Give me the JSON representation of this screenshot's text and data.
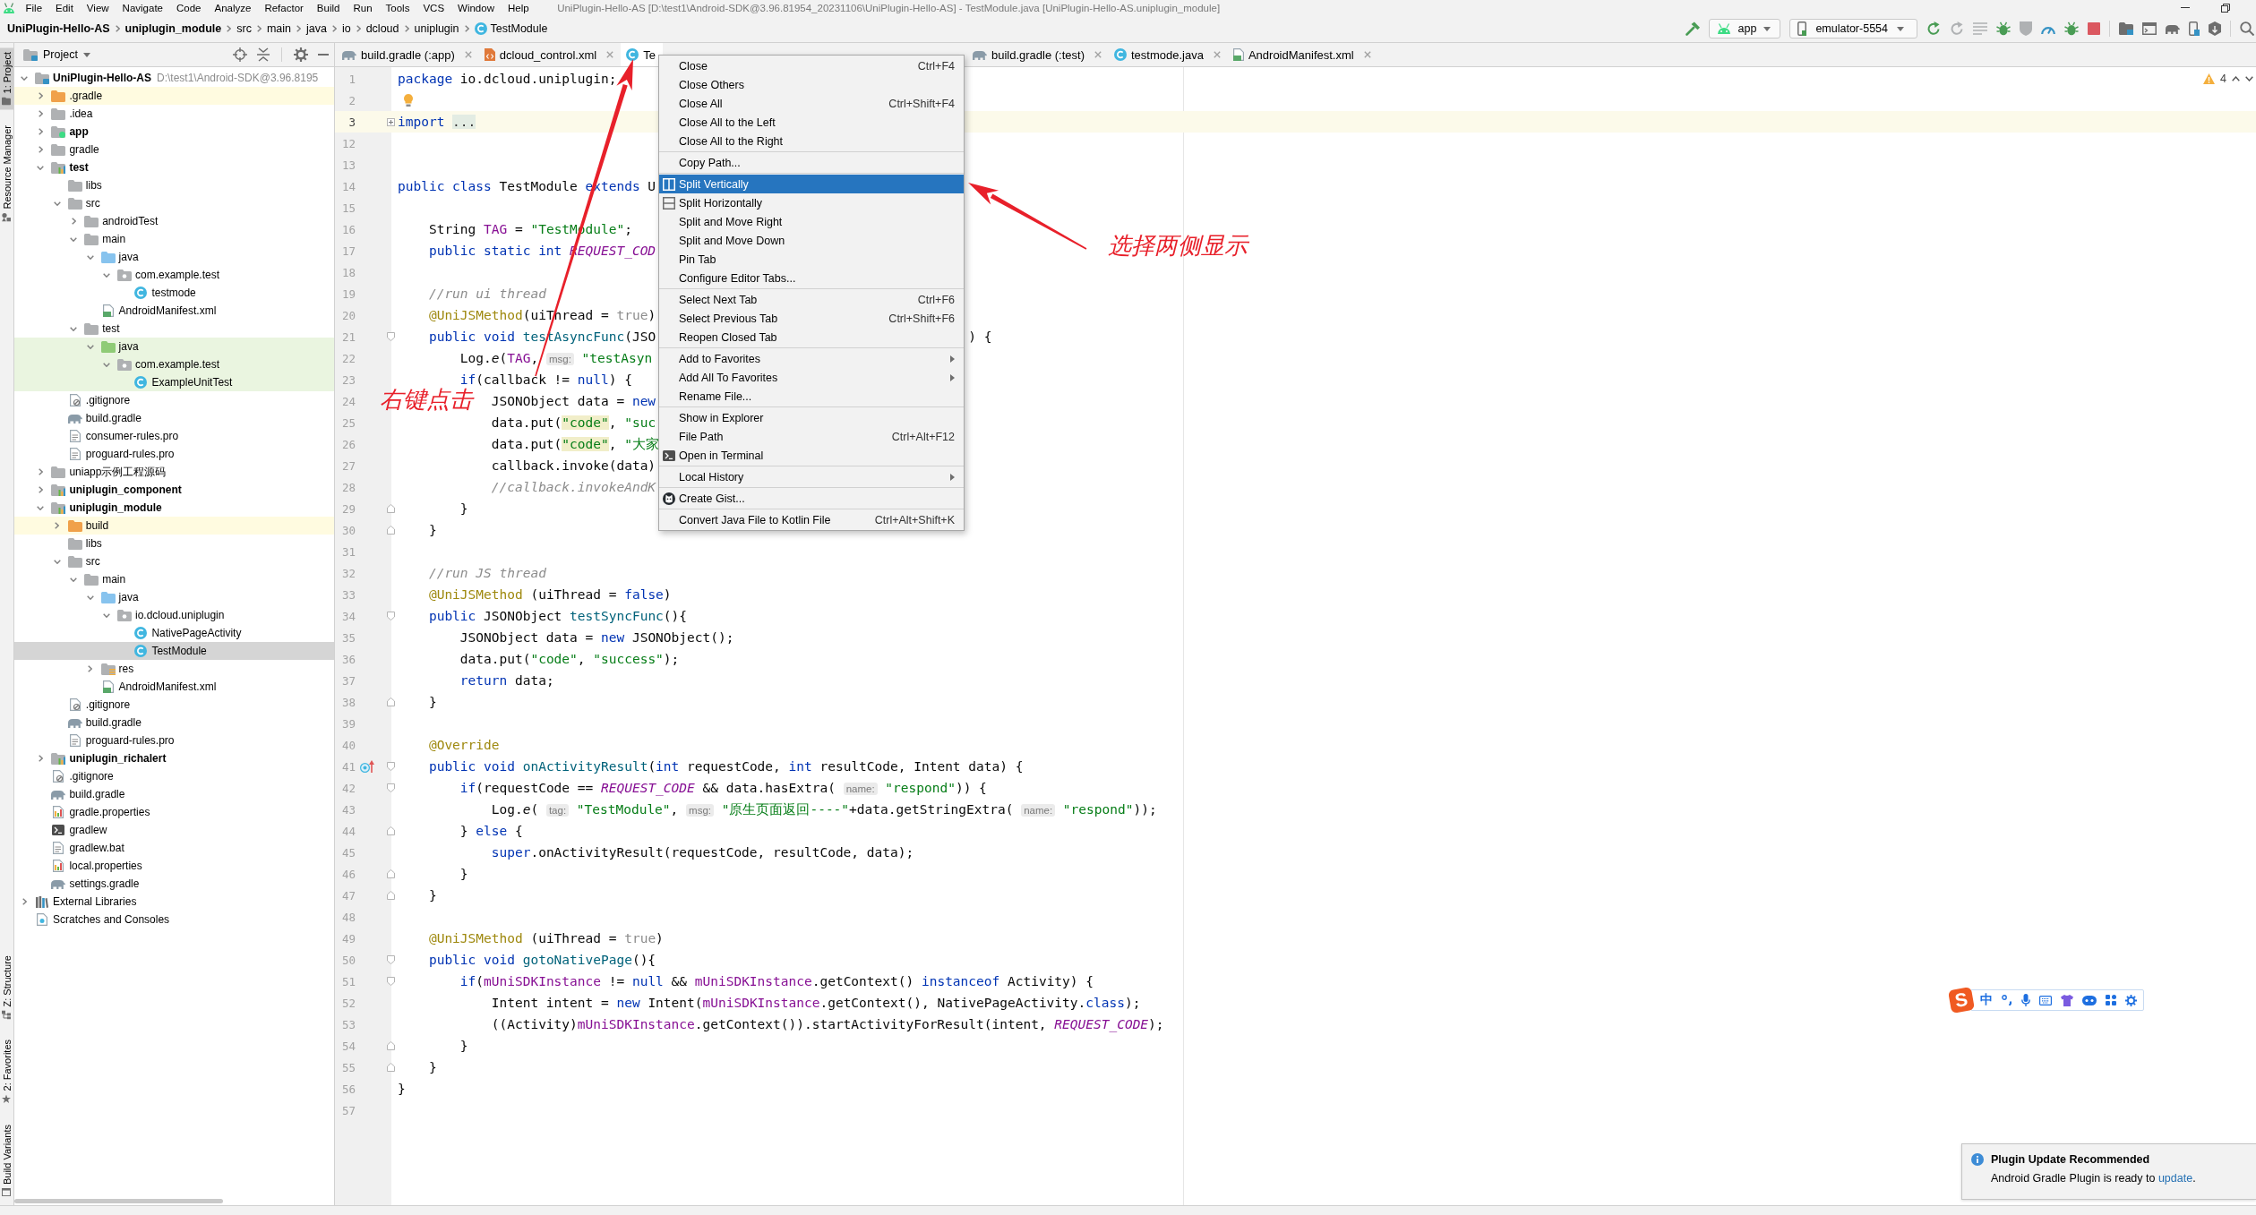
{
  "window": {
    "title": "UniPlugin-Hello-AS [D:\\test1\\Android-SDK@3.96.81954_20231106\\UniPlugin-Hello-AS] - TestModule.java [UniPlugin-Hello-AS.uniplugin_module]"
  },
  "menu_bar": [
    "File",
    "Edit",
    "View",
    "Navigate",
    "Code",
    "Analyze",
    "Refactor",
    "Build",
    "Run",
    "Tools",
    "VCS",
    "Window",
    "Help"
  ],
  "breadcrumbs": [
    {
      "label": "UniPlugin-Hello-AS",
      "kind": "project"
    },
    {
      "label": "uniplugin_module",
      "kind": "module"
    },
    {
      "label": "src",
      "kind": "folder"
    },
    {
      "label": "main",
      "kind": "folder"
    },
    {
      "label": "java",
      "kind": "folder"
    },
    {
      "label": "io",
      "kind": "folder"
    },
    {
      "label": "dcloud",
      "kind": "folder"
    },
    {
      "label": "uniplugin",
      "kind": "folder"
    },
    {
      "label": "TestModule",
      "kind": "class"
    }
  ],
  "run_toolbar": {
    "configuration": "app",
    "device": "emulator-5554"
  },
  "tool_windows": {
    "top": [
      {
        "label": "1: Project",
        "kind": "project",
        "selected": true
      },
      {
        "label": "Resource Manager",
        "kind": "resources",
        "selected": false
      }
    ],
    "bottom": [
      {
        "label": "Z: Structure",
        "kind": "structure",
        "selected": false
      },
      {
        "label": "2: Favorites",
        "kind": "favorites",
        "selected": false
      },
      {
        "label": "Build Variants",
        "kind": "variants",
        "selected": false
      }
    ]
  },
  "project_panel": {
    "title": "Project",
    "tree": [
      {
        "label": "UniPlugin-Hello-AS",
        "path": "D:\\test1\\Android-SDK@3.96.8195",
        "kind": "project",
        "expanded": true,
        "selected": false,
        "children": [
          {
            "label": ".gradle",
            "kind": "excluded-folder",
            "expanded": false,
            "selected": false
          },
          {
            "label": ".idea",
            "kind": "folder",
            "expanded": false,
            "selected": false
          },
          {
            "label": "app",
            "kind": "app-module",
            "expanded": false,
            "selected": false
          },
          {
            "label": "gradle",
            "kind": "folder",
            "expanded": false,
            "selected": false
          },
          {
            "label": "test",
            "kind": "library-module",
            "expanded": true,
            "selected": false,
            "children": [
              {
                "label": "libs",
                "kind": "folder",
                "selected": false
              },
              {
                "label": "src",
                "kind": "folder",
                "expanded": true,
                "selected": false,
                "children": [
                  {
                    "label": "androidTest",
                    "kind": "folder",
                    "expanded": false,
                    "selected": false
                  },
                  {
                    "label": "main",
                    "kind": "folder",
                    "expanded": true,
                    "selected": false,
                    "children": [
                      {
                        "label": "java",
                        "kind": "source-folder",
                        "expanded": true,
                        "selected": false,
                        "children": [
                          {
                            "label": "com.example.test",
                            "kind": "package",
                            "expanded": true,
                            "selected": false,
                            "children": [
                              {
                                "label": "testmode",
                                "kind": "class",
                                "selected": false
                              }
                            ]
                          }
                        ]
                      },
                      {
                        "label": "AndroidManifest.xml",
                        "kind": "manifest",
                        "selected": false
                      }
                    ]
                  },
                  {
                    "label": "test",
                    "kind": "folder",
                    "expanded": true,
                    "selected": false,
                    "children": [
                      {
                        "label": "java",
                        "kind": "test-folder",
                        "expanded": true,
                        "selected": false,
                        "children": [
                          {
                            "label": "com.example.test",
                            "kind": "package",
                            "expanded": true,
                            "selected": false,
                            "children": [
                              {
                                "label": "ExampleUnitTest",
                                "kind": "class",
                                "selected": false
                              }
                            ]
                          }
                        ]
                      }
                    ]
                  }
                ]
              },
              {
                "label": ".gitignore",
                "kind": "ignore-file",
                "selected": false
              },
              {
                "label": "build.gradle",
                "kind": "gradle-file",
                "selected": false
              },
              {
                "label": "consumer-rules.pro",
                "kind": "text-file",
                "selected": false
              },
              {
                "label": "proguard-rules.pro",
                "kind": "text-file",
                "selected": false
              }
            ]
          },
          {
            "label": "uniapp示例工程源码",
            "kind": "folder",
            "expanded": false,
            "selected": false
          },
          {
            "label": "uniplugin_component",
            "kind": "library-module",
            "expanded": false,
            "selected": false
          },
          {
            "label": "uniplugin_module",
            "kind": "library-module",
            "expanded": true,
            "selected": false,
            "children": [
              {
                "label": "build",
                "kind": "excluded-folder",
                "expanded": false,
                "selected": false
              },
              {
                "label": "libs",
                "kind": "folder",
                "selected": false
              },
              {
                "label": "src",
                "kind": "folder",
                "expanded": true,
                "selected": false,
                "children": [
                  {
                    "label": "main",
                    "kind": "folder",
                    "expanded": true,
                    "selected": false,
                    "children": [
                      {
                        "label": "java",
                        "kind": "source-folder",
                        "expanded": true,
                        "selected": false,
                        "children": [
                          {
                            "label": "io.dcloud.uniplugin",
                            "kind": "package",
                            "expanded": true,
                            "selected": false,
                            "children": [
                              {
                                "label": "NativePageActivity",
                                "kind": "class",
                                "selected": false
                              },
                              {
                                "label": "TestModule",
                                "kind": "class",
                                "selected": true
                              }
                            ]
                          }
                        ]
                      },
                      {
                        "label": "res",
                        "kind": "resource-folder",
                        "expanded": false,
                        "selected": false
                      },
                      {
                        "label": "AndroidManifest.xml",
                        "kind": "manifest",
                        "selected": false
                      }
                    ]
                  }
                ]
              },
              {
                "label": ".gitignore",
                "kind": "ignore-file",
                "selected": false
              },
              {
                "label": "build.gradle",
                "kind": "gradle-file",
                "selected": false
              },
              {
                "label": "proguard-rules.pro",
                "kind": "text-file",
                "selected": false
              }
            ]
          },
          {
            "label": "uniplugin_richalert",
            "kind": "library-module",
            "expanded": false,
            "selected": false
          },
          {
            "label": ".gitignore",
            "kind": "ignore-file",
            "selected": false
          },
          {
            "label": "build.gradle",
            "kind": "gradle-file",
            "selected": false
          },
          {
            "label": "gradle.properties",
            "kind": "properties-file",
            "selected": false
          },
          {
            "label": "gradlew",
            "kind": "script",
            "selected": false
          },
          {
            "label": "gradlew.bat",
            "kind": "text-file",
            "selected": false
          },
          {
            "label": "local.properties",
            "kind": "properties-file",
            "selected": false
          },
          {
            "label": "settings.gradle",
            "kind": "gradle-file",
            "selected": false
          }
        ]
      },
      {
        "label": "External Libraries",
        "kind": "libraries",
        "expanded": false,
        "selected": false
      },
      {
        "label": "Scratches and Consoles",
        "kind": "scratches",
        "selected": false
      }
    ]
  },
  "editor_tabs": [
    {
      "label": "build.gradle (:app)",
      "kind": "gradle",
      "selected": false
    },
    {
      "label": "dcloud_control.xml",
      "kind": "xml",
      "selected": false
    },
    {
      "label": "Te",
      "kind": "java",
      "selected": true
    },
    {
      "label": "build.gradle (:test)",
      "kind": "gradle",
      "selected": false
    },
    {
      "label": "testmode.java",
      "kind": "java",
      "selected": false
    },
    {
      "label": "AndroidManifest.xml",
      "kind": "manifest",
      "selected": false
    }
  ],
  "editor": {
    "problems": "4",
    "lines": [
      {
        "number": "1",
        "current": false,
        "tokens": [
          {
            "kind": "kw",
            "text": "package"
          },
          {
            "kind": "txt",
            "text": " io.dcloud.uniplugin;"
          }
        ]
      },
      {
        "number": "2",
        "current": false,
        "markers": [
          {
            "kind": "intention"
          }
        ]
      },
      {
        "number": "3",
        "current": true,
        "markers": [
          {
            "kind": "folded"
          }
        ],
        "tokens": [
          {
            "kind": "kw",
            "text": "import "
          },
          {
            "kind": "folded",
            "text": "..."
          }
        ]
      },
      {
        "number": "12",
        "current": false
      },
      {
        "number": "13",
        "current": false
      },
      {
        "number": "14",
        "current": false,
        "tokens": [
          {
            "kind": "kw",
            "text": "public class"
          },
          {
            "kind": "txt",
            "text": " TestModule "
          },
          {
            "kind": "kw",
            "text": "extends"
          },
          {
            "kind": "txt",
            "text": " U"
          }
        ]
      },
      {
        "number": "15",
        "current": false
      },
      {
        "number": "16",
        "current": false,
        "tokens": [
          {
            "kind": "txt",
            "text": "    String "
          },
          {
            "kind": "field",
            "text": "TAG"
          },
          {
            "kind": "txt",
            "text": " = "
          },
          {
            "kind": "str",
            "text": "\"TestModule\""
          },
          {
            "kind": "txt",
            "text": ";"
          }
        ]
      },
      {
        "number": "17",
        "current": false,
        "tokens": [
          {
            "kind": "kw",
            "text": "    public static int "
          },
          {
            "kind": "const",
            "text": "REQUEST_COD"
          }
        ]
      },
      {
        "number": "18",
        "current": false
      },
      {
        "number": "19",
        "current": false,
        "tokens": [
          {
            "kind": "comment",
            "text": "    //run ui thread"
          }
        ]
      },
      {
        "number": "20",
        "current": false,
        "tokens": [
          {
            "kind": "annotation",
            "text": "    @UniJSMethod"
          },
          {
            "kind": "txt",
            "text": "(uiThread = "
          },
          {
            "kind": "muted",
            "text": "true"
          },
          {
            "kind": "txt",
            "text": ")"
          }
        ]
      },
      {
        "number": "21",
        "current": false,
        "markers": [
          {
            "kind": "fold-start"
          }
        ],
        "tokens": [
          {
            "kind": "kw",
            "text": "    public void "
          },
          {
            "kind": "method",
            "text": "testAsyncFunc"
          },
          {
            "kind": "txt",
            "text": "(JSO"
          }
        ],
        "tail": [
          {
            "kind": "txt",
            "text": ") {"
          }
        ]
      },
      {
        "number": "22",
        "current": false,
        "tokens": [
          {
            "kind": "txt",
            "text": "        Log."
          },
          {
            "kind": "call",
            "text": "e"
          },
          {
            "kind": "txt",
            "text": "("
          },
          {
            "kind": "field",
            "text": "TAG"
          },
          {
            "kind": "txt",
            "text": ", "
          },
          {
            "kind": "hint",
            "text": "msg:"
          },
          {
            "kind": "str",
            "text": " \"testAsyn"
          }
        ]
      },
      {
        "number": "23",
        "current": false,
        "tokens": [
          {
            "kind": "kw",
            "text": "        if"
          },
          {
            "kind": "txt",
            "text": "(callback != "
          },
          {
            "kind": "kw",
            "text": "null"
          },
          {
            "kind": "txt",
            "text": ") {"
          }
        ]
      },
      {
        "number": "24",
        "current": false,
        "tokens": [
          {
            "kind": "txt",
            "text": "            JSONObject data = "
          },
          {
            "kind": "kw",
            "text": "new"
          }
        ]
      },
      {
        "number": "25",
        "current": false,
        "tokens": [
          {
            "kind": "txt",
            "text": "            data.put("
          },
          {
            "kind": "marked",
            "text": "\"code\""
          },
          {
            "kind": "txt",
            "text": ", "
          },
          {
            "kind": "str",
            "text": "\"suc"
          }
        ]
      },
      {
        "number": "26",
        "current": false,
        "tokens": [
          {
            "kind": "txt",
            "text": "            data.put("
          },
          {
            "kind": "marked",
            "text": "\"code\""
          },
          {
            "kind": "txt",
            "text": ", "
          },
          {
            "kind": "str",
            "text": "\"大家"
          }
        ]
      },
      {
        "number": "27",
        "current": false,
        "tokens": [
          {
            "kind": "txt",
            "text": "            callback.invoke(data)"
          }
        ]
      },
      {
        "number": "28",
        "current": false,
        "tokens": [
          {
            "kind": "comment",
            "text": "            //callback.invokeAndK"
          }
        ]
      },
      {
        "number": "29",
        "current": false,
        "markers": [
          {
            "kind": "fold-end"
          }
        ],
        "tokens": [
          {
            "kind": "txt",
            "text": "        }"
          }
        ]
      },
      {
        "number": "30",
        "current": false,
        "markers": [
          {
            "kind": "fold-end"
          }
        ],
        "tokens": [
          {
            "kind": "txt",
            "text": "    }"
          }
        ]
      },
      {
        "number": "31",
        "current": false
      },
      {
        "number": "32",
        "current": false,
        "tokens": [
          {
            "kind": "comment",
            "text": "    //run JS thread"
          }
        ]
      },
      {
        "number": "33",
        "current": false,
        "tokens": [
          {
            "kind": "annotation",
            "text": "    @UniJSMethod"
          },
          {
            "kind": "txt",
            "text": " (uiThread = "
          },
          {
            "kind": "kw",
            "text": "false"
          },
          {
            "kind": "txt",
            "text": ")"
          }
        ]
      },
      {
        "number": "34",
        "current": false,
        "markers": [
          {
            "kind": "fold-start"
          }
        ],
        "tokens": [
          {
            "kind": "kw",
            "text": "    public"
          },
          {
            "kind": "txt",
            "text": " JSONObject "
          },
          {
            "kind": "method",
            "text": "testSyncFunc"
          },
          {
            "kind": "txt",
            "text": "(){"
          }
        ]
      },
      {
        "number": "35",
        "current": false,
        "tokens": [
          {
            "kind": "txt",
            "text": "        JSONObject data = "
          },
          {
            "kind": "kw",
            "text": "new"
          },
          {
            "kind": "txt",
            "text": " JSONObject();"
          }
        ]
      },
      {
        "number": "36",
        "current": false,
        "tokens": [
          {
            "kind": "txt",
            "text": "        data.put("
          },
          {
            "kind": "str",
            "text": "\"code\""
          },
          {
            "kind": "txt",
            "text": ", "
          },
          {
            "kind": "str",
            "text": "\"success\""
          },
          {
            "kind": "txt",
            "text": ");"
          }
        ]
      },
      {
        "number": "37",
        "current": false,
        "tokens": [
          {
            "kind": "kw",
            "text": "        return"
          },
          {
            "kind": "txt",
            "text": " data;"
          }
        ]
      },
      {
        "number": "38",
        "current": false,
        "markers": [
          {
            "kind": "fold-end"
          }
        ],
        "tokens": [
          {
            "kind": "txt",
            "text": "    }"
          }
        ]
      },
      {
        "number": "39",
        "current": false
      },
      {
        "number": "40",
        "current": false,
        "tokens": [
          {
            "kind": "annotation",
            "text": "    @Override"
          }
        ]
      },
      {
        "number": "41",
        "current": false,
        "markers": [
          {
            "kind": "override"
          },
          {
            "kind": "fold-start"
          }
        ],
        "tokens": [
          {
            "kind": "kw",
            "text": "    public void "
          },
          {
            "kind": "method",
            "text": "onActivityResult"
          },
          {
            "kind": "txt",
            "text": "("
          },
          {
            "kind": "kw",
            "text": "int"
          },
          {
            "kind": "txt",
            "text": " requestCode, "
          },
          {
            "kind": "kw",
            "text": "int"
          },
          {
            "kind": "txt",
            "text": " resultCode, Intent data) {"
          }
        ]
      },
      {
        "number": "42",
        "current": false,
        "markers": [
          {
            "kind": "fold-start"
          }
        ],
        "tokens": [
          {
            "kind": "kw",
            "text": "        if"
          },
          {
            "kind": "txt",
            "text": "(requestCode == "
          },
          {
            "kind": "const",
            "text": "REQUEST_CODE"
          },
          {
            "kind": "txt",
            "text": " && data.hasExtra( "
          },
          {
            "kind": "hint",
            "text": "name:"
          },
          {
            "kind": "str",
            "text": " \"respond\""
          },
          {
            "kind": "txt",
            "text": ")) {"
          }
        ]
      },
      {
        "number": "43",
        "current": false,
        "tokens": [
          {
            "kind": "txt",
            "text": "            Log."
          },
          {
            "kind": "call",
            "text": "e"
          },
          {
            "kind": "txt",
            "text": "( "
          },
          {
            "kind": "hint",
            "text": "tag:"
          },
          {
            "kind": "str",
            "text": " \"TestModule\""
          },
          {
            "kind": "txt",
            "text": ", "
          },
          {
            "kind": "hint",
            "text": "msg:"
          },
          {
            "kind": "str",
            "text": " \"原生页面返回----\""
          },
          {
            "kind": "txt",
            "text": "+data.getStringExtra( "
          },
          {
            "kind": "hint",
            "text": "name:"
          },
          {
            "kind": "str",
            "text": " \"respond\""
          },
          {
            "kind": "txt",
            "text": "));"
          }
        ]
      },
      {
        "number": "44",
        "current": false,
        "markers": [
          {
            "kind": "fold-end"
          }
        ],
        "tokens": [
          {
            "kind": "txt",
            "text": "        } "
          },
          {
            "kind": "kw",
            "text": "else"
          },
          {
            "kind": "txt",
            "text": " {"
          }
        ]
      },
      {
        "number": "45",
        "current": false,
        "tokens": [
          {
            "kind": "kw",
            "text": "            super"
          },
          {
            "kind": "txt",
            "text": ".onActivityResult(requestCode, resultCode, data);"
          }
        ]
      },
      {
        "number": "46",
        "current": false,
        "markers": [
          {
            "kind": "fold-end"
          }
        ],
        "tokens": [
          {
            "kind": "txt",
            "text": "        }"
          }
        ]
      },
      {
        "number": "47",
        "current": false,
        "markers": [
          {
            "kind": "fold-end"
          }
        ],
        "tokens": [
          {
            "kind": "txt",
            "text": "    }"
          }
        ]
      },
      {
        "number": "48",
        "current": false
      },
      {
        "number": "49",
        "current": false,
        "tokens": [
          {
            "kind": "annotation",
            "text": "    @UniJSMethod"
          },
          {
            "kind": "txt",
            "text": " (uiThread = "
          },
          {
            "kind": "muted",
            "text": "true"
          },
          {
            "kind": "txt",
            "text": ")"
          }
        ]
      },
      {
        "number": "50",
        "current": false,
        "markers": [
          {
            "kind": "fold-start"
          }
        ],
        "tokens": [
          {
            "kind": "kw",
            "text": "    public void "
          },
          {
            "kind": "method",
            "text": "gotoNativePage"
          },
          {
            "kind": "txt",
            "text": "(){"
          }
        ]
      },
      {
        "number": "51",
        "current": false,
        "markers": [
          {
            "kind": "fold-start"
          }
        ],
        "tokens": [
          {
            "kind": "kw",
            "text": "        if"
          },
          {
            "kind": "txt",
            "text": "("
          },
          {
            "kind": "field",
            "text": "mUniSDKInstance"
          },
          {
            "kind": "txt",
            "text": " != "
          },
          {
            "kind": "kw",
            "text": "null"
          },
          {
            "kind": "txt",
            "text": " && "
          },
          {
            "kind": "field",
            "text": "mUniSDKInstance"
          },
          {
            "kind": "txt",
            "text": ".getContext() "
          },
          {
            "kind": "kw",
            "text": "instanceof"
          },
          {
            "kind": "txt",
            "text": " Activity) {"
          }
        ]
      },
      {
        "number": "52",
        "current": false,
        "tokens": [
          {
            "kind": "txt",
            "text": "            Intent intent = "
          },
          {
            "kind": "kw",
            "text": "new"
          },
          {
            "kind": "txt",
            "text": " Intent("
          },
          {
            "kind": "field",
            "text": "mUniSDKInstance"
          },
          {
            "kind": "txt",
            "text": ".getContext(), NativePageActivity."
          },
          {
            "kind": "kw",
            "text": "class"
          },
          {
            "kind": "txt",
            "text": ");"
          }
        ]
      },
      {
        "number": "53",
        "current": false,
        "tokens": [
          {
            "kind": "txt",
            "text": "            ((Activity)"
          },
          {
            "kind": "field",
            "text": "mUniSDKInstance"
          },
          {
            "kind": "txt",
            "text": ".getContext()).startActivityForResult(intent, "
          },
          {
            "kind": "const",
            "text": "REQUEST_CODE"
          },
          {
            "kind": "txt",
            "text": ");"
          }
        ]
      },
      {
        "number": "54",
        "current": false,
        "markers": [
          {
            "kind": "fold-end"
          }
        ],
        "tokens": [
          {
            "kind": "txt",
            "text": "        }"
          }
        ]
      },
      {
        "number": "55",
        "current": false,
        "markers": [
          {
            "kind": "fold-end"
          }
        ],
        "tokens": [
          {
            "kind": "txt",
            "text": "    }"
          }
        ]
      },
      {
        "number": "56",
        "current": false,
        "tokens": [
          {
            "kind": "txt",
            "text": "}"
          }
        ]
      },
      {
        "number": "57",
        "current": false
      }
    ]
  },
  "context_menu": {
    "groups": [
      [
        {
          "label": "Close",
          "shortcut": "Ctrl+F4",
          "kind": "command",
          "selected": false
        },
        {
          "label": "Close Others",
          "kind": "command",
          "selected": false
        },
        {
          "label": "Close All",
          "shortcut": "Ctrl+Shift+F4",
          "kind": "command",
          "selected": false
        },
        {
          "label": "Close All to the Left",
          "kind": "command",
          "selected": false
        },
        {
          "label": "Close All to the Right",
          "kind": "command",
          "selected": false
        }
      ],
      [
        {
          "label": "Copy Path...",
          "kind": "command",
          "selected": false
        }
      ],
      [
        {
          "label": "Split Vertically",
          "kind": "split-vertical",
          "selected": true
        },
        {
          "label": "Split Horizontally",
          "kind": "split-horizontal",
          "selected": false
        },
        {
          "label": "Split and Move Right",
          "kind": "command",
          "selected": false
        },
        {
          "label": "Split and Move Down",
          "kind": "command",
          "selected": false
        },
        {
          "label": "Pin Tab",
          "kind": "command",
          "selected": false
        },
        {
          "label": "Configure Editor Tabs...",
          "kind": "command",
          "selected": false
        }
      ],
      [
        {
          "label": "Select Next Tab",
          "shortcut": "Ctrl+F6",
          "kind": "command",
          "selected": false
        },
        {
          "label": "Select Previous Tab",
          "shortcut": "Ctrl+Shift+F6",
          "kind": "command",
          "selected": false
        },
        {
          "label": "Reopen Closed Tab",
          "kind": "command",
          "selected": false
        }
      ],
      [
        {
          "label": "Add to Favorites",
          "kind": "submenu",
          "selected": false
        },
        {
          "label": "Add All To Favorites",
          "kind": "submenu",
          "selected": false
        },
        {
          "label": "Rename File...",
          "kind": "command",
          "selected": false
        }
      ],
      [
        {
          "label": "Show in Explorer",
          "kind": "command",
          "selected": false
        },
        {
          "label": "File Path",
          "shortcut": "Ctrl+Alt+F12",
          "kind": "command",
          "selected": false
        },
        {
          "label": "Open in Terminal",
          "kind": "terminal",
          "selected": false
        }
      ],
      [
        {
          "label": "Local History",
          "kind": "submenu",
          "selected": false
        }
      ],
      [
        {
          "label": "Create Gist...",
          "kind": "gist",
          "selected": false
        }
      ],
      [
        {
          "label": "Convert Java File to Kotlin File",
          "shortcut": "Ctrl+Alt+Shift+K",
          "kind": "command",
          "selected": false
        }
      ]
    ]
  },
  "annotations": [
    {
      "text": "右键点击"
    },
    {
      "text": "选择两侧显示"
    }
  ],
  "ime_toolbar": {
    "logo": "S",
    "mode": "中"
  },
  "notification": {
    "title": "Plugin Update Recommended",
    "text": "Android Gradle Plugin is ready to ",
    "link": "update",
    "text_after": "."
  }
}
